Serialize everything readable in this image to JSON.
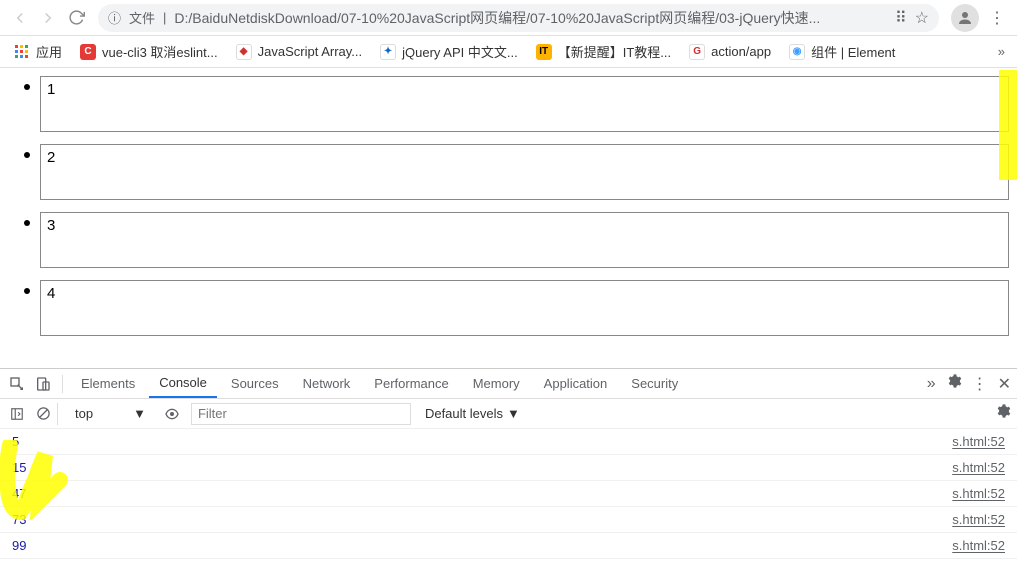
{
  "browser": {
    "address_prefix": "文件",
    "url": "D:/BaiduNetdiskDownload/07-10%20JavaScript网页编程/07-10%20JavaScript网页编程/03-jQuery快速..."
  },
  "bookmarks": {
    "apps_label": "应用",
    "items": [
      {
        "label": "vue-cli3 取消eslint...",
        "bg": "#e53935",
        "glyph": "C"
      },
      {
        "label": "JavaScript Array...",
        "bg": "#ffffff",
        "glyph": "◆",
        "fg": "#d32f2f"
      },
      {
        "label": "jQuery API 中文文...",
        "bg": "#ffffff",
        "glyph": "✦",
        "fg": "#1565c0"
      },
      {
        "label": "【新提醒】IT教程...",
        "bg": "#ffb300",
        "glyph": "IT",
        "fg": "#000"
      },
      {
        "label": "action/app",
        "bg": "#ffffff",
        "glyph": "G",
        "fg": "#d32f2f"
      },
      {
        "label": "组件 | Element",
        "bg": "#ffffff",
        "glyph": "◉",
        "fg": "#409eff"
      }
    ]
  },
  "page": {
    "items": [
      "1",
      "2",
      "3",
      "4"
    ]
  },
  "devtools": {
    "tabs": [
      "Elements",
      "Console",
      "Sources",
      "Network",
      "Performance",
      "Memory",
      "Application",
      "Security"
    ],
    "active_tab": "Console",
    "context": "top",
    "filter_placeholder": "Filter",
    "levels": "Default levels",
    "logs": [
      {
        "value": "5",
        "source": "s.html:52"
      },
      {
        "value": "15",
        "source": "s.html:52"
      },
      {
        "value": "47",
        "source": "s.html:52"
      },
      {
        "value": "73",
        "source": "s.html:52"
      },
      {
        "value": "99",
        "source": "s.html:52"
      }
    ]
  }
}
